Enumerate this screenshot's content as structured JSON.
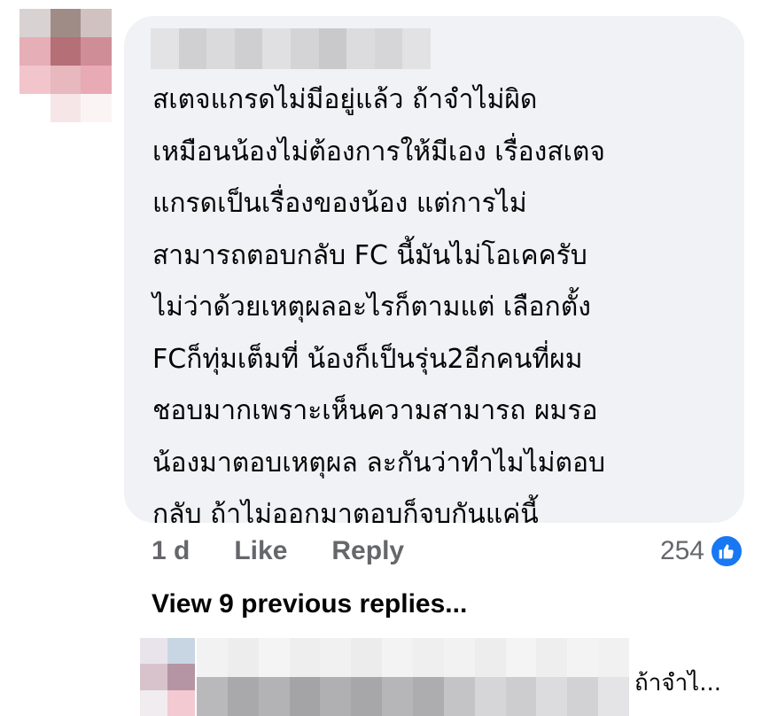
{
  "comment": {
    "lines": [
      "สเตจแกรดไม่มีอยู่แล้ว ถ้าจำไม่ผิด",
      "เหมือนน้องไม่ต้องการให้มีเอง เรื่องสเตจ",
      "แกรดเป็นเรื่องของน้อง แต่การไม่",
      "สามารถตอบกลับ FC นี้มันไม่โอเคครับ",
      "ไม่ว่าด้วยเหตุผลอะไรก็ตามแต่ เลือกตั้ง",
      "FCก็ทุ่มเต็มที่ น้องก็เป็นรุ่น2อีกคนที่ผม",
      "ชอบมากเพราะเห็นความสามารถ ผมรอ",
      "น้องมาตอบเหตุผล ละกันว่าทำไมไม่ตอบ",
      "กลับ ถ้าไม่ออกมาตอบก็จบกันแค่นี้"
    ],
    "time": "1 d",
    "like_label": "Like",
    "reply_label": "Reply",
    "reaction_count": "254",
    "reaction_icon": "thumbs-up-icon"
  },
  "view_replies_label": "View 9 previous replies...",
  "latest_reply": {
    "preview_text": "ถ้าจำไ..."
  },
  "colors": {
    "bubble": "#f0f2f5",
    "text": "#050505",
    "secondary_text": "#65676b",
    "like_blue": "#1877f2"
  }
}
